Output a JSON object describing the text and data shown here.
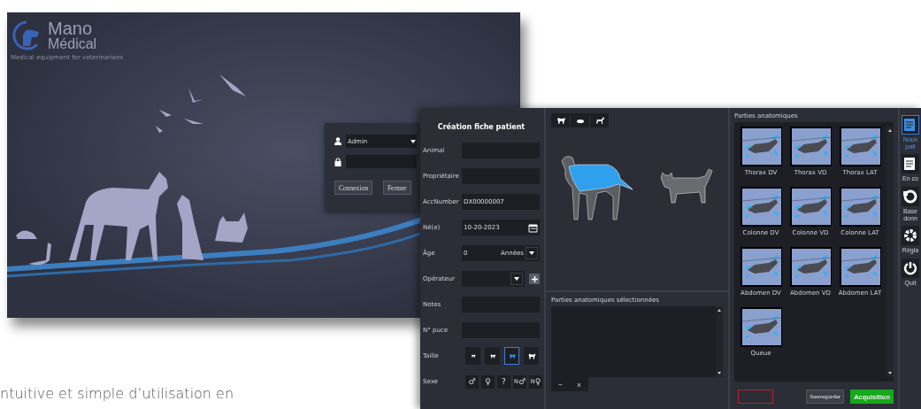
{
  "login_window": {
    "logo": {
      "name": "Mano",
      "subtitle": "Médical",
      "tagline": "Medical equipment for veterinarians"
    },
    "login": {
      "user": "Admin",
      "buttons": [
        "Connexion",
        "Fermer"
      ]
    }
  },
  "patient_window": {
    "form": {
      "title": "Création fiche patient",
      "fields": [
        {
          "kind": "text",
          "label": "Animal"
        },
        {
          "kind": "text",
          "label": "Propriétaire"
        },
        {
          "kind": "text",
          "label": "AccNumber",
          "value": "DX00000007"
        },
        {
          "kind": "date",
          "label": "Né(e)",
          "value": "10-20-2023"
        },
        {
          "kind": "number_unit",
          "label": "Âge",
          "value": "0",
          "unit": "Années"
        },
        {
          "kind": "select_add",
          "label": "Opérateur"
        },
        {
          "kind": "text",
          "label": "Notes"
        },
        {
          "kind": "text",
          "label": "N° puce"
        },
        {
          "kind": "size",
          "label": "Taille",
          "options": [
            {
              "selected": false
            },
            {
              "selected": false
            },
            {
              "selected": true
            },
            {
              "selected": false
            }
          ]
        },
        {
          "kind": "sex",
          "label": "Sexe",
          "options": [
            {
              "symbol": "♂"
            },
            {
              "symbol": "♀"
            },
            {
              "symbol": "?"
            },
            {
              "symbol": "$^{N}$♂"
            },
            {
              "symbol": "$^{N}$♀"
            }
          ]
        }
      ]
    },
    "selected_parts": {
      "title": "Parties anatomiques sélectionnées",
      "buttons": [
        "−",
        "x"
      ]
    },
    "anatomy": {
      "title": "Parties anatomiques",
      "items": [
        {
          "label": "Thorax DV"
        },
        {
          "label": "Thorax VD"
        },
        {
          "label": "Thorax LAT"
        },
        {
          "label": "Colonne DV"
        },
        {
          "label": "Colonne VD"
        },
        {
          "label": "Colonne LAT"
        },
        {
          "label": "Abdomen DV"
        },
        {
          "label": "Abdomen VD"
        },
        {
          "label": "Abdomen LAT"
        },
        {
          "label": "Queue"
        }
      ],
      "actions": [
        {
          "kind": "danger"
        },
        {
          "kind": "normal",
          "label": "Sauvegarder"
        },
        {
          "kind": "primary",
          "label": "Acquisition"
        }
      ]
    },
    "sidebar": {
      "items": [
        {
          "lines": [
            "Nouv",
            "pati"
          ],
          "selected": true
        },
        {
          "lines": [
            "En co"
          ],
          "selected": false
        },
        {
          "lines": [
            "Base",
            "donn"
          ],
          "selected": false
        },
        {
          "lines": [
            "Régla"
          ],
          "selected": false
        },
        {
          "lines": [
            "Quit"
          ],
          "selected": false
        }
      ]
    }
  },
  "page_text": "ntuitive et simple d’utilisation en"
}
